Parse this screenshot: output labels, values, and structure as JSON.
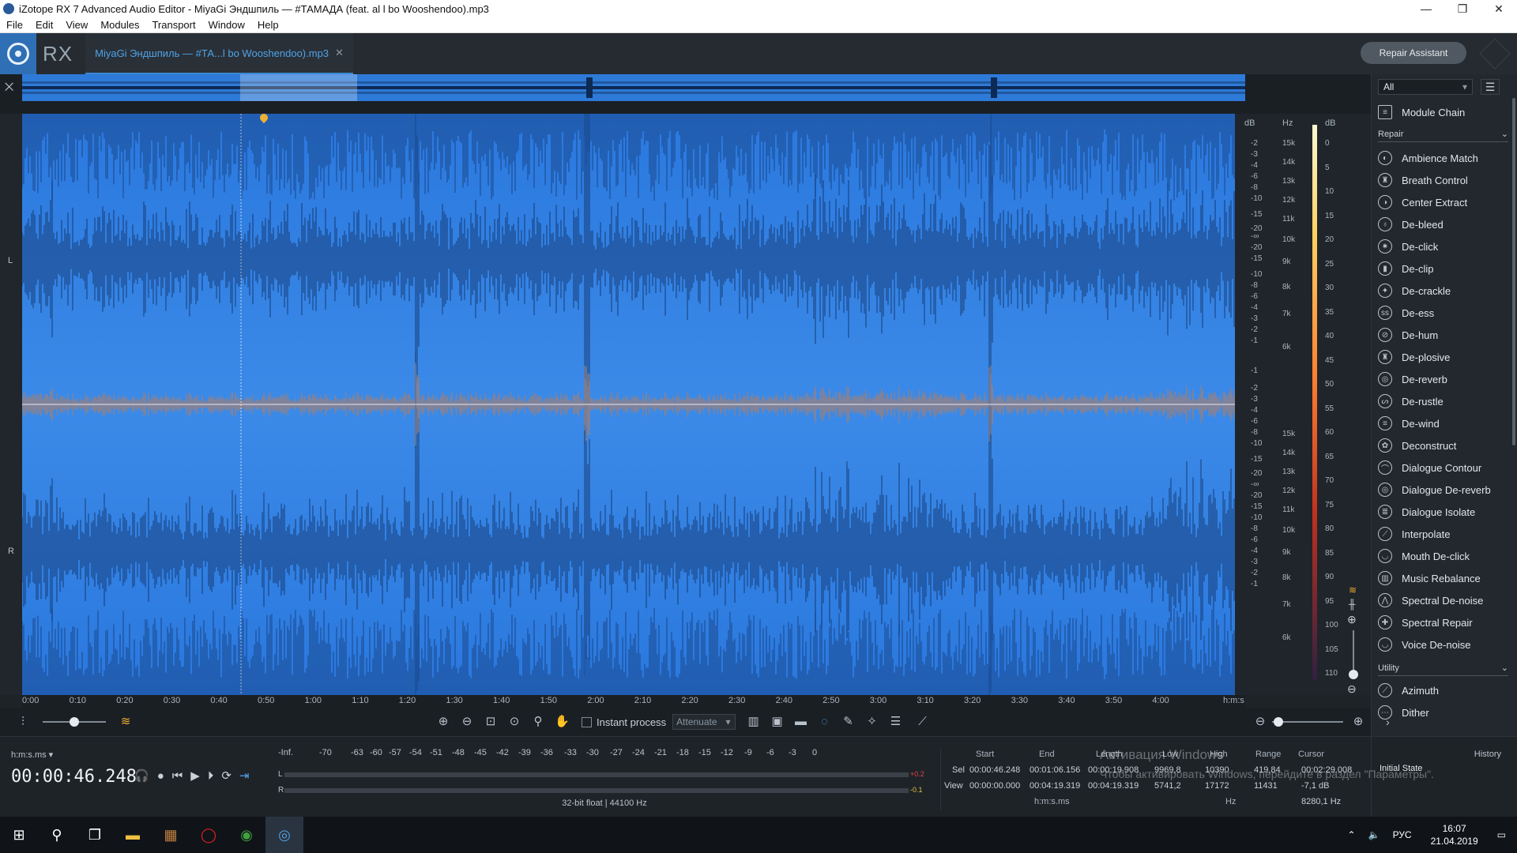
{
  "window": {
    "title": "iZotope RX 7 Advanced Audio Editor - MiyaGi  Эндшпиль — #ТАМАДА (feat. al l bo  Wooshendoo).mp3",
    "controls": [
      "—",
      "❐",
      "✕"
    ]
  },
  "menu": [
    "File",
    "Edit",
    "View",
    "Modules",
    "Transport",
    "Window",
    "Help"
  ],
  "header": {
    "logo_text": "RX",
    "file_tab": "MiyaGi  Эндшпиль — #ТА...l bo  Wooshendoo).mp3",
    "repair_assistant": "Repair Assistant"
  },
  "channels": {
    "left": "L",
    "right": "R"
  },
  "axes": {
    "db_label": "dB",
    "hz_label": "Hz",
    "db_scale_label": "dB",
    "db_left": [
      "-2",
      "-3",
      "-4",
      "-6",
      "-8",
      "-10",
      "-15",
      "-20",
      "-∞",
      "-20",
      "-15",
      "-10",
      "-8",
      "-6",
      "-4",
      "-3",
      "-2",
      "-1"
    ],
    "hz_left": [
      "15k",
      "14k",
      "13k",
      "12k",
      "11k",
      "10k",
      "9k",
      "8k",
      "7k",
      "6k"
    ],
    "db_right": [
      "-1",
      "-2",
      "-3",
      "-4",
      "-6",
      "-8",
      "-10",
      "-15",
      "-20",
      "-∞",
      "-20",
      "-15",
      "-10",
      "-8",
      "-6",
      "-4",
      "-3",
      "-2",
      "-1"
    ],
    "hz_right": [
      "15k",
      "14k",
      "13k",
      "12k",
      "11k",
      "10k",
      "9k",
      "8k",
      "7k",
      "6k"
    ],
    "colorbar_scale": [
      "0",
      "5",
      "10",
      "15",
      "20",
      "25",
      "30",
      "35",
      "40",
      "45",
      "50",
      "55",
      "60",
      "65",
      "70",
      "75",
      "80",
      "85",
      "90",
      "95",
      "100",
      "105",
      "110"
    ]
  },
  "time_ruler": [
    "0:00",
    "0:10",
    "0:20",
    "0:30",
    "0:40",
    "0:50",
    "1:00",
    "1:10",
    "1:20",
    "1:30",
    "1:40",
    "1:50",
    "2:00",
    "2:10",
    "2:20",
    "2:30",
    "2:40",
    "2:50",
    "3:00",
    "3:10",
    "3:20",
    "3:30",
    "3:40",
    "3:50",
    "4:00",
    "h:m:s"
  ],
  "toolbar": {
    "instant_process": "Instant process",
    "mode": "Attenuate"
  },
  "transport": {
    "time_format": "h:m:s.ms",
    "current_time": "00:00:46.248"
  },
  "meter": {
    "scale": [
      "-Inf.",
      "-70",
      "-63",
      "-60",
      "-57",
      "-54",
      "-51",
      "-48",
      "-45",
      "-42",
      "-39",
      "-36",
      "-33",
      "-30",
      "-27",
      "-24",
      "-21",
      "-18",
      "-15",
      "-12",
      "-9",
      "-6",
      "-3",
      "0"
    ],
    "left_label": "L",
    "right_label": "R",
    "left_peak": "+0.2",
    "right_peak": "-0.1",
    "format": "32-bit float | 44100 Hz"
  },
  "selection": {
    "headers": [
      "Start",
      "End",
      "Length",
      "Low",
      "High",
      "Range",
      "Cursor"
    ],
    "sel_label": "Sel",
    "view_label": "View",
    "sel": [
      "00:00:46.248",
      "00:01:06.156",
      "00:00:19.908",
      "9969,8",
      "10390",
      "419,84",
      "00:02:29.008"
    ],
    "view": [
      "00:00:00.000",
      "00:04:19.319",
      "00:04:19.319",
      "5741,2",
      "17172",
      "11431",
      "-7,1 dB"
    ],
    "unit_time": "h:m:s.ms",
    "unit_hz": "Hz",
    "cursor_hz": "8280,1 Hz"
  },
  "history": {
    "title": "History",
    "item": "Initial State"
  },
  "watermark": {
    "line1": "Активация Windows",
    "line2": "Чтобы активировать Windows, перейдите в раздел \"Параметры\"."
  },
  "sidebar": {
    "filter": "All",
    "module_chain": "Module Chain",
    "repair_header": "Repair",
    "repair_items": [
      "Ambience Match",
      "Breath Control",
      "Center Extract",
      "De-bleed",
      "De-click",
      "De-clip",
      "De-crackle",
      "De-ess",
      "De-hum",
      "De-plosive",
      "De-reverb",
      "De-rustle",
      "De-wind",
      "Deconstruct",
      "Dialogue Contour",
      "Dialogue De-reverb",
      "Dialogue Isolate",
      "Interpolate",
      "Mouth De-click",
      "Music Rebalance",
      "Spectral De-noise",
      "Spectral Repair",
      "Voice De-noise"
    ],
    "utility_header": "Utility",
    "utility_items": [
      "Azimuth",
      "Dither"
    ]
  },
  "taskbar": {
    "lang": "РУС",
    "time": "16:07",
    "date": "21.04.2019"
  }
}
